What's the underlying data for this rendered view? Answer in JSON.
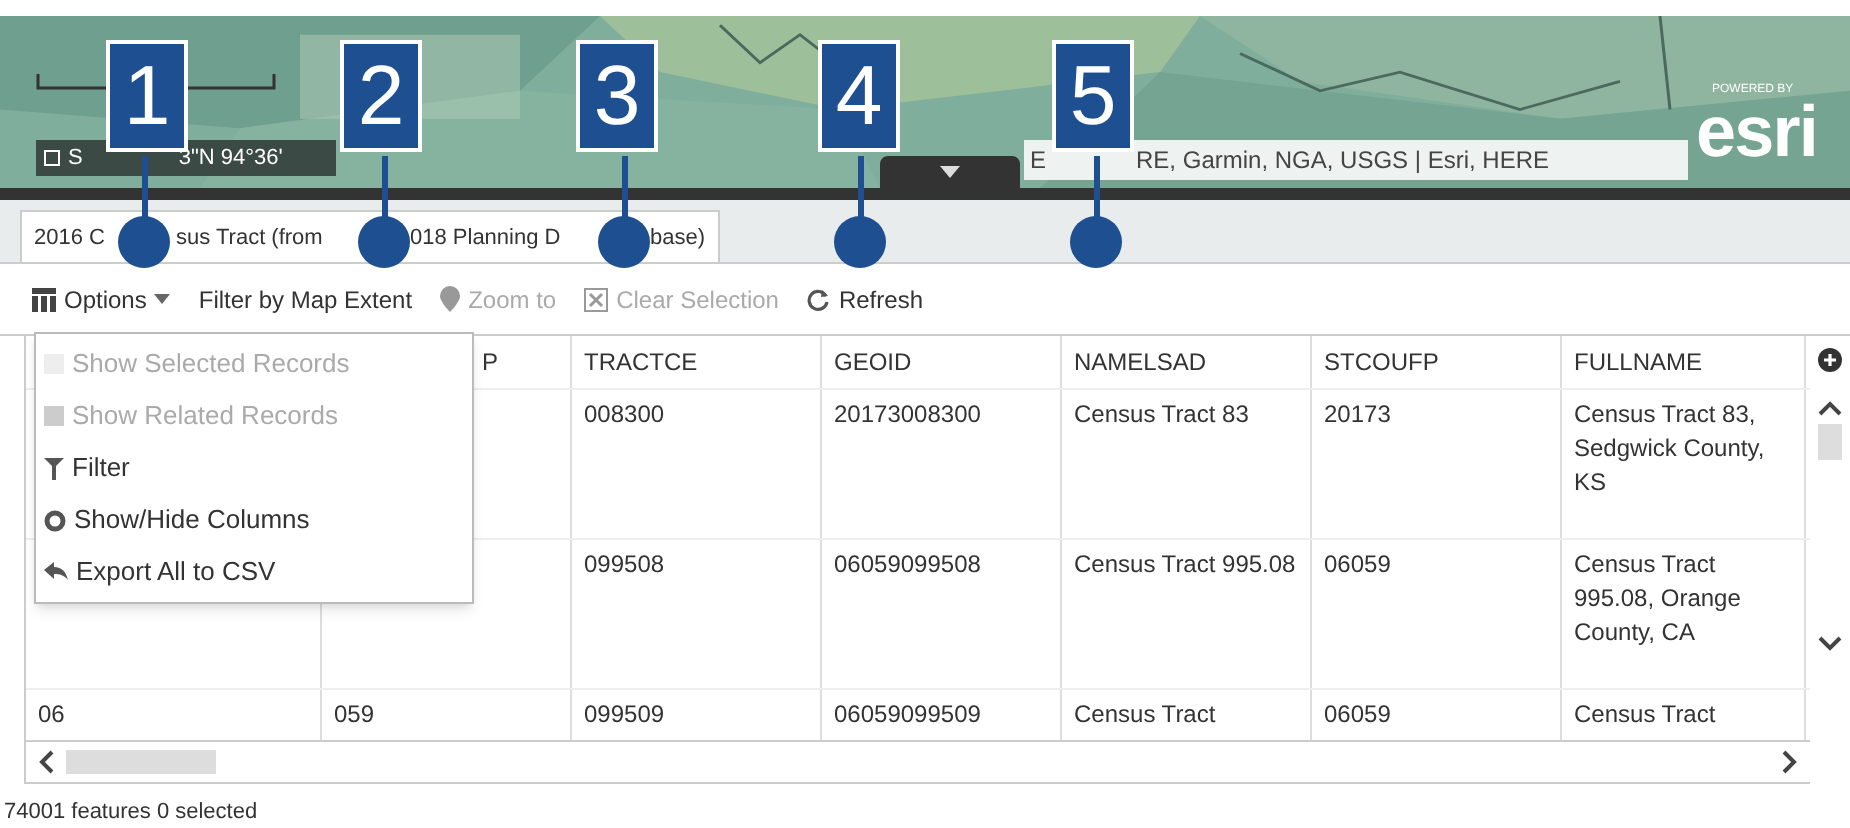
{
  "map": {
    "kind": "picture",
    "coordinates": [
      "S",
      "3\"N 94°36'"
    ],
    "attribution": [
      "E",
      "RE, Garmin, NGA, USGS | Esri, HERE"
    ],
    "logo_caption": "POWERED BY",
    "logo": "esri"
  },
  "callouts": [
    "1",
    "2",
    "3",
    "4",
    "5"
  ],
  "tab": {
    "title_parts": [
      "2016 C",
      "sus Tract (from",
      "018 Planning D",
      "base)"
    ],
    "selected": true
  },
  "toolbar": [
    {
      "kind": "options",
      "label": "Options",
      "disabled": false
    },
    {
      "kind": "plain",
      "label": "Filter by Map Extent",
      "disabled": false
    },
    {
      "kind": "zoom",
      "label": "Zoom to",
      "disabled": true
    },
    {
      "kind": "clear",
      "label": "Clear Selection",
      "disabled": true
    },
    {
      "kind": "refresh",
      "label": "Refresh",
      "disabled": false
    }
  ],
  "options_menu": [
    {
      "kind": "selected",
      "label": "Show Selected Records",
      "disabled": true
    },
    {
      "kind": "related",
      "label": "Show Related Records",
      "disabled": true
    },
    {
      "kind": "filter",
      "label": "Filter",
      "disabled": false
    },
    {
      "kind": "columns",
      "label": "Show/Hide Columns",
      "disabled": false
    },
    {
      "kind": "export",
      "label": "Export All to CSV",
      "disabled": false
    }
  ],
  "table": {
    "columns": [
      null,
      "P",
      "TRACTCE",
      "GEOID",
      "NAMELSAD",
      "STCOUFP",
      "FULLNAME"
    ],
    "rows": [
      [
        null,
        null,
        "008300",
        "20173008300",
        "Census Tract 83",
        "20173",
        "Census Tract 83, Sedgwick County, KS"
      ],
      [
        null,
        null,
        "099508",
        "06059099508",
        "Census Tract 995.08",
        "06059",
        "Census Tract 995.08, Orange County, CA"
      ],
      [
        "06",
        "059",
        "099509",
        "06059099509",
        "Census Tract",
        "06059",
        "Census Tract"
      ]
    ]
  },
  "status_bar": "74001 features 0 selected"
}
